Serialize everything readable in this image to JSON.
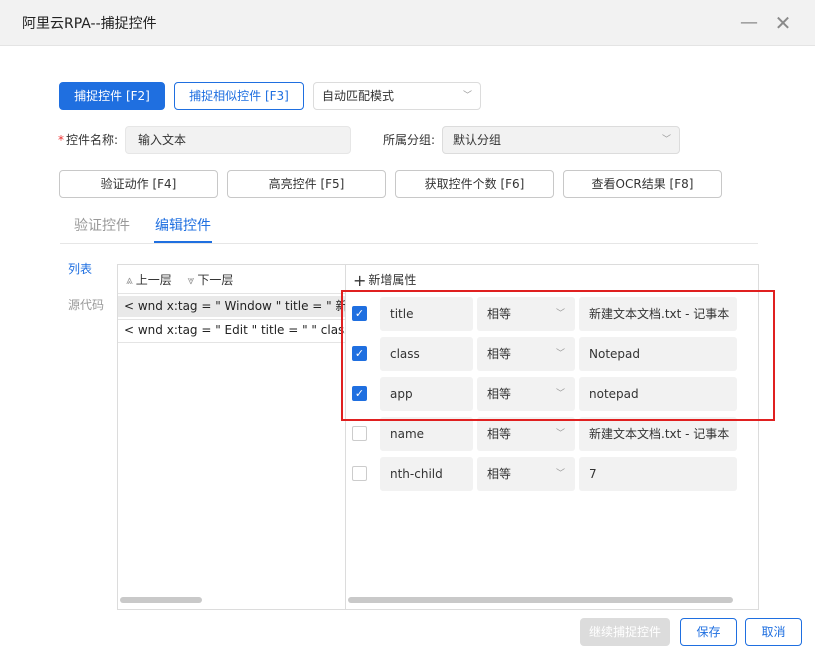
{
  "window": {
    "title": "阿里云RPA--捕捉控件",
    "minimize": "—",
    "close": "✕"
  },
  "toolbar": {
    "capture": "捕捉控件 [F2]",
    "capture_similar": "捕捉相似控件 [F3]",
    "mode": "自动匹配模式"
  },
  "form": {
    "name_label": "控件名称:",
    "name_value": "输入文本",
    "group_label": "所属分组:",
    "group_value": "默认分组"
  },
  "actions": {
    "verify": "验证动作 [F4]",
    "highlight": "高亮控件 [F5]",
    "count": "获取控件个数 [F6]",
    "ocr": "查看OCR结果 [F8]"
  },
  "tabs": {
    "verify": "验证控件",
    "edit": "编辑控件"
  },
  "side": {
    "list": "列表",
    "source": "源代码"
  },
  "tree": {
    "up": "上一层",
    "down": "下一层",
    "rows": [
      "< wnd  x:tag = \" Window \"  title = \" 新建",
      "< wnd  x:tag = \" Edit \"  title = \" \"  class"
    ]
  },
  "attrs": {
    "add": "新增属性",
    "rows": [
      {
        "checked": true,
        "name": "title",
        "op": "相等",
        "value": "新建文本文档.txt - 记事本"
      },
      {
        "checked": true,
        "name": "class",
        "op": "相等",
        "value": "Notepad"
      },
      {
        "checked": true,
        "name": "app",
        "op": "相等",
        "value": "notepad"
      },
      {
        "checked": false,
        "name": "name",
        "op": "相等",
        "value": "新建文本文档.txt - 记事本"
      },
      {
        "checked": false,
        "name": "nth-child",
        "op": "相等",
        "value": "7"
      }
    ]
  },
  "footer": {
    "continue": "继续捕捉控件",
    "save": "保存",
    "cancel": "取消"
  },
  "icons": {
    "up": "⩓",
    "down": "⩔",
    "plus": "+",
    "check": "✓",
    "chevron": "﹀"
  },
  "colors": {
    "accent": "#1f6fe0",
    "highlight": "#e02020"
  }
}
